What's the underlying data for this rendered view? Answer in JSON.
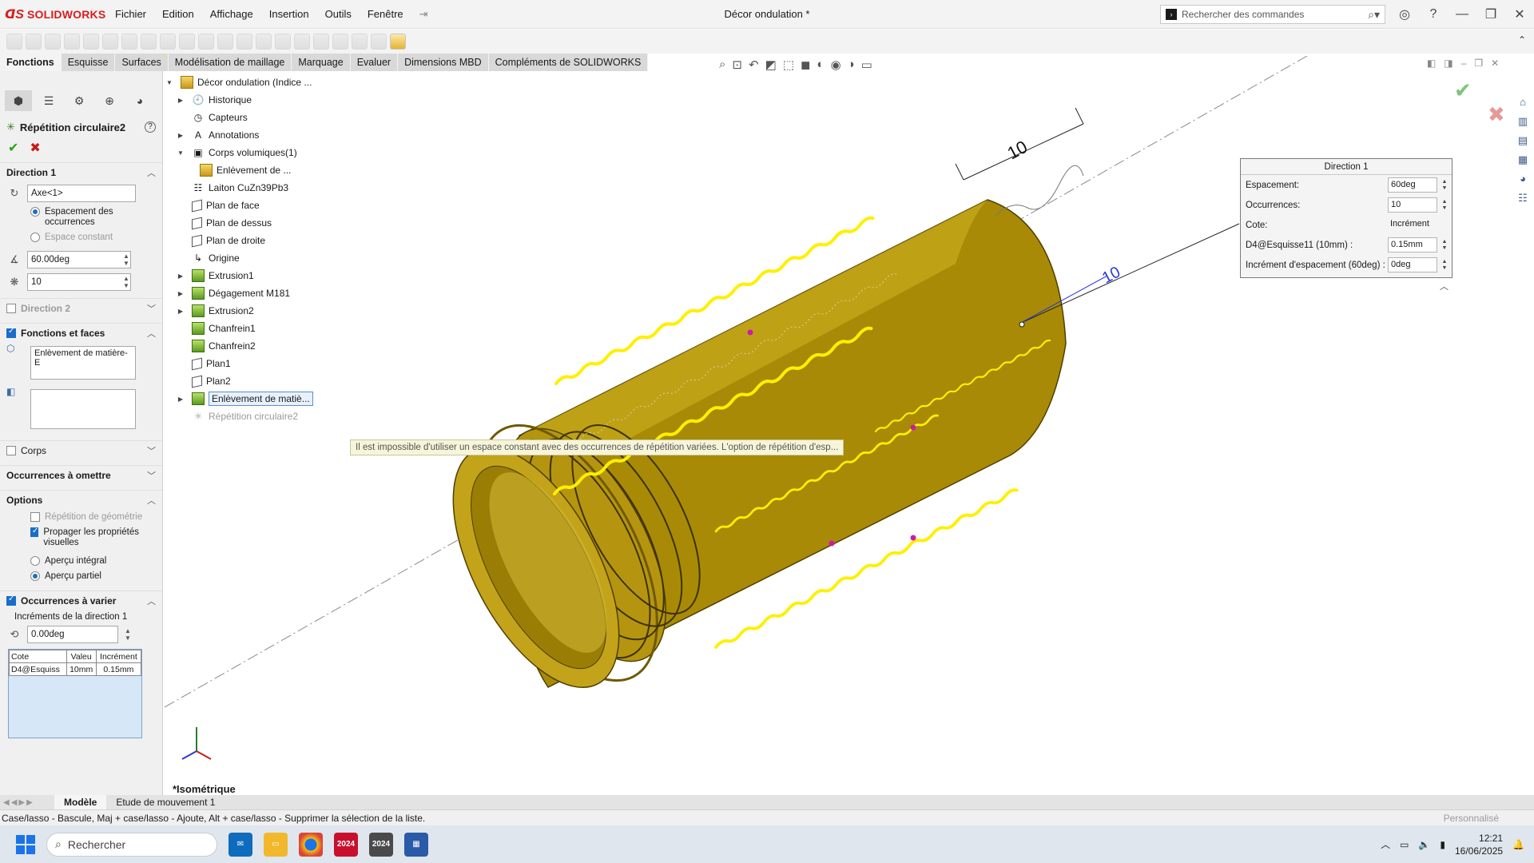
{
  "app": {
    "name": "SOLIDWORKS",
    "document_title": "Décor ondulation *",
    "menu": [
      "Fichier",
      "Edition",
      "Affichage",
      "Insertion",
      "Outils",
      "Fenêtre"
    ],
    "search_placeholder": "Rechercher des commandes"
  },
  "command_tabs": [
    "Fonctions",
    "Esquisse",
    "Surfaces",
    "Modélisation de maillage",
    "Marquage",
    "Evaluer",
    "Dimensions MBD",
    "Compléments de SOLIDWORKS"
  ],
  "property_manager": {
    "title": "Répétition circulaire2",
    "direction1": {
      "header": "Direction 1",
      "axis": "Axe<1>",
      "opt_spacing": "Espacement des occurrences",
      "opt_constant": "Espace constant",
      "angle": "60.00deg",
      "count": "10"
    },
    "direction2": "Direction 2",
    "features_faces": {
      "header": "Fonctions et faces",
      "feature": "Enlèvement de matière-E"
    },
    "bodies": "Corps",
    "skip": "Occurrences à omettre",
    "options": {
      "header": "Options",
      "geom": "Répétition de géométrie",
      "propagate": "Propager les propriétés visuelles",
      "full_preview": "Aperçu intégral",
      "partial_preview": "Aperçu partiel"
    },
    "vary": {
      "header": "Occurrences à varier",
      "sub": "Incréments de la direction 1",
      "angle_inc": "0.00deg",
      "table_headers": [
        "Cote",
        "Valeu",
        "Incrément"
      ],
      "table_rows": [
        [
          "D4@Esquiss",
          "10mm",
          "0.15mm"
        ]
      ]
    }
  },
  "tree": {
    "root": "Décor ondulation (Indice ...",
    "items": [
      {
        "label": "Historique",
        "icon": "history-icon"
      },
      {
        "label": "Capteurs",
        "icon": "sensor-icon"
      },
      {
        "label": "Annotations",
        "icon": "annotation-icon"
      },
      {
        "label": "Corps volumiques(1)",
        "icon": "solid-bodies-icon"
      },
      {
        "label": "Enlèvement de ...",
        "icon": "body-icon"
      },
      {
        "label": "Laiton CuZn39Pb3",
        "icon": "material-icon"
      },
      {
        "label": "Plan de face",
        "icon": "plane-icon"
      },
      {
        "label": "Plan de dessus",
        "icon": "plane-icon"
      },
      {
        "label": "Plan de droite",
        "icon": "plane-icon"
      },
      {
        "label": "Origine",
        "icon": "origin-icon"
      },
      {
        "label": "Extrusion1",
        "icon": "extrude-icon"
      },
      {
        "label": "Dégagement M181",
        "icon": "hole-icon"
      },
      {
        "label": "Extrusion2",
        "icon": "extrude-icon"
      },
      {
        "label": "Chanfrein1",
        "icon": "chamfer-icon"
      },
      {
        "label": "Chanfrein2",
        "icon": "chamfer-icon"
      },
      {
        "label": "Plan1",
        "icon": "plane-icon"
      },
      {
        "label": "Plan2",
        "icon": "plane-icon"
      },
      {
        "label": "Enlèvement de matiè...",
        "icon": "cut-icon"
      },
      {
        "label": "Répétition circulaire2",
        "icon": "circular-pattern-icon"
      }
    ]
  },
  "tooltip": "Il est impossible d'utiliser un espace constant avec des occurrences de répétition variées. L'option de répétition d'esp...",
  "viewport": {
    "dimension": "10",
    "view_name": "*Isométrique",
    "popup": {
      "title": "Direction 1",
      "rows": [
        {
          "label": "Espacement:",
          "value": "60deg"
        },
        {
          "label": "Occurrences:",
          "value": "10"
        },
        {
          "label": "Cote:",
          "value": "Incrément"
        },
        {
          "label": "D4@Esquisse11 (10mm) :",
          "value": "0.15mm"
        },
        {
          "label": "Incrément d'espacement (60deg) :",
          "value": "0deg"
        }
      ]
    },
    "part_color": "#b89a0c",
    "highlight_color": "#ffef00"
  },
  "bottom_tabs": [
    "Modèle",
    "Etude de mouvement 1"
  ],
  "status": {
    "text": "Case/lasso - Bascule, Maj + case/lasso - Ajoute, Alt + case/lasso - Supprimer la sélection de la liste.",
    "mode": "Personnalisé"
  },
  "taskbar": {
    "search": "Rechercher",
    "time": "12:21",
    "date": "16/06/2025",
    "app_badge": "2024"
  }
}
